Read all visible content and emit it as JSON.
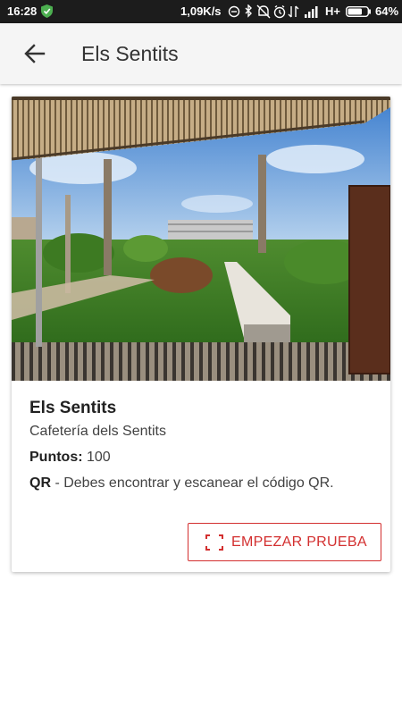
{
  "status_bar": {
    "time": "16:28",
    "speed": "1,09K/s",
    "network": "H+",
    "battery_percent": "64%",
    "icons": [
      "shield-check-icon",
      "alarm-off-icon",
      "bluetooth-icon",
      "bell-off-icon",
      "alarm-icon",
      "data-transfer-icon",
      "signal-icon",
      "battery-icon"
    ]
  },
  "app_bar": {
    "title": "Els Sentits",
    "back_icon": "arrow-left-icon"
  },
  "card": {
    "image_icon": "park-photo",
    "title": "Els Sentits",
    "subtitle": "Cafetería dels Sentits",
    "points_label": "Puntos:",
    "points_value": "100",
    "qr_label": "QR",
    "qr_text": " - Debes encontrar y escanear el código QR.",
    "button_label": "EMPEZAR PRUEBA",
    "button_icon": "qr-scan-icon"
  },
  "colors": {
    "accent": "#d32f2f",
    "status_bar": "#1c1c1c",
    "app_bar": "#f5f5f5"
  }
}
